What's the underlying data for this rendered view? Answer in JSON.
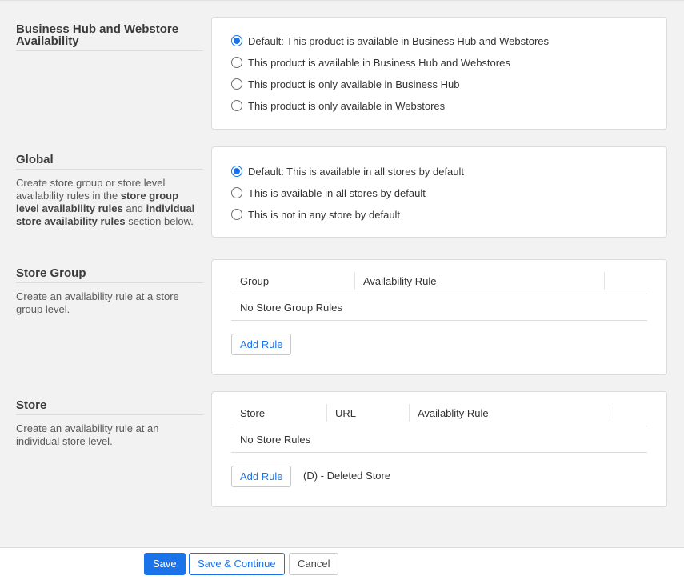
{
  "availability": {
    "title": "Business Hub and Webstore Availability",
    "options": [
      {
        "label": "Default: This product is available in Business Hub and Webstores",
        "checked": true
      },
      {
        "label": "This product is available in Business Hub and Webstores",
        "checked": false
      },
      {
        "label": "This product is only available in Business Hub",
        "checked": false
      },
      {
        "label": "This product is only available in Webstores",
        "checked": false
      }
    ]
  },
  "global": {
    "title": "Global",
    "desc_1": "Create store group or store level availability rules in the ",
    "desc_bold_1": "store group level availability rules",
    "desc_2": " and ",
    "desc_bold_2": "individual store availability rules",
    "desc_3": " section below.",
    "options": [
      {
        "label": "Default: This is available in all stores by default",
        "checked": true
      },
      {
        "label": "This is available in all stores by default",
        "checked": false
      },
      {
        "label": "This is not in any store by default",
        "checked": false
      }
    ]
  },
  "store_group": {
    "title": "Store Group",
    "desc": "Create an availability rule at a store group level.",
    "columns": [
      "Group",
      "Availability Rule"
    ],
    "empty_text": "No Store Group Rules",
    "add_rule_label": "Add Rule"
  },
  "store": {
    "title": "Store",
    "desc": "Create an availability rule at an individual store level.",
    "columns": [
      "Store",
      "URL",
      "Availablity Rule"
    ],
    "empty_text": "No Store Rules",
    "add_rule_label": "Add Rule",
    "deleted_note": "(D) - Deleted Store"
  },
  "footer": {
    "save_label": "Save",
    "save_continue_label": "Save & Continue",
    "cancel_label": "Cancel"
  },
  "colors": {
    "accent": "#1a73e8",
    "page_bg": "#f2f2f3",
    "panel_bg": "#ffffff"
  }
}
